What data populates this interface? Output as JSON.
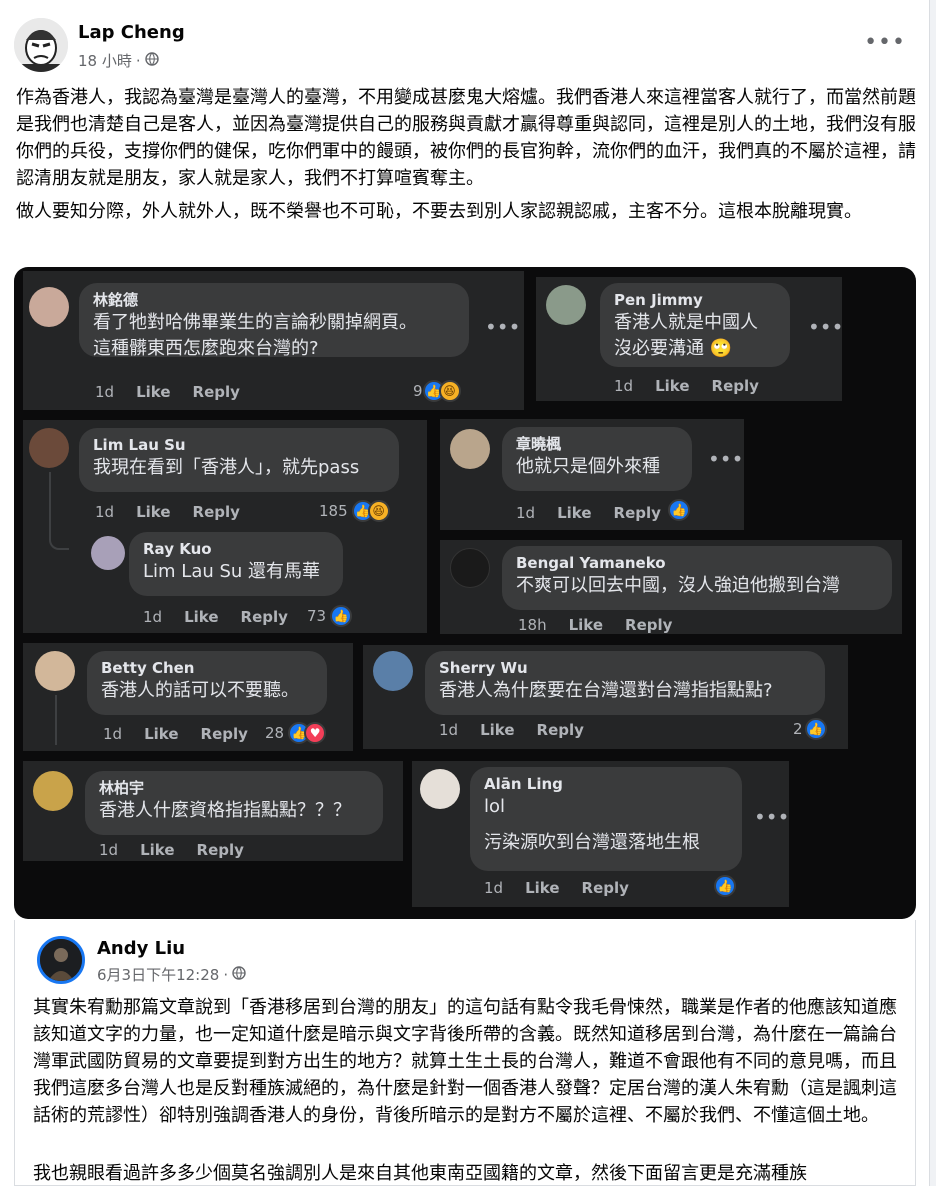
{
  "post": {
    "author": "Lap Cheng",
    "time": "18 小時",
    "separator": "·",
    "privacy_icon": "globe-icon",
    "more": "•••",
    "paragraphs": [
      "作為香港人，我認為臺灣是臺灣人的臺灣，不用變成甚麼鬼大熔爐。我們香港人來這裡當客人就行了，而當然前題是我們也清楚自己是客人，並因為臺灣提供自己的服務與貢獻才贏得尊重與認同，這裡是別人的土地，我們沒有服你們的兵役，支撐你們的健保，吃你們軍中的饅頭，被你們的長官狗幹，流你們的血汗，我們真的不屬於這裡，請認清朋友就是朋友，家人就是家人，我們不打算喧賓奪主。",
      "做人要知分際，外人就外人，既不榮譽也不可恥，不要去到別人家認親認戚，主客不分。這根本脫離現實。"
    ]
  },
  "comments": {
    "like": "Like",
    "reply": "Reply",
    "dots": "•••",
    "items": [
      {
        "name": "林銘德",
        "lines": [
          "看了牠對哈佛畢業生的言論秒關掉網頁。",
          "這種髒東西怎麼跑來台灣的?"
        ],
        "time": "1d",
        "count": "9"
      },
      {
        "name": "Pen Jimmy",
        "lines": [
          "香港人就是中國人",
          "沒必要溝通"
        ],
        "time": "1d",
        "count": ""
      },
      {
        "name": "Lim Lau Su",
        "lines": [
          "我現在看到「香港人」，就先pass"
        ],
        "time": "1d",
        "count": "185"
      },
      {
        "name": "章曉楓",
        "lines": [
          "他就只是個外來種"
        ],
        "time": "1d",
        "count": ""
      },
      {
        "name": "Ray Kuo",
        "lines": [
          "Lim Lau Su 還有馬華"
        ],
        "time": "1d",
        "count": "73"
      },
      {
        "name": "Bengal Yamaneko",
        "lines": [
          "不爽可以回去中國，沒人強迫他搬到台灣"
        ],
        "time": "18h",
        "count": ""
      },
      {
        "name": "Betty Chen",
        "lines": [
          "香港人的話可以不要聽。"
        ],
        "time": "1d",
        "count": "28"
      },
      {
        "name": "Sherry Wu",
        "lines": [
          "香港人為什麼要在台灣還對台灣指指點點?"
        ],
        "time": "1d",
        "count": "2"
      },
      {
        "name": "林柏宇",
        "lines": [
          "香港人什麼資格指指點點？？？"
        ],
        "time": "1d",
        "count": ""
      },
      {
        "name": "Alān Ling",
        "lines": [
          "lol",
          "污染源吹到台灣還落地生根"
        ],
        "time": "1d",
        "count": ""
      }
    ]
  },
  "shared": {
    "author": "Andy Liu",
    "time": "6月3日下午12:28",
    "separator": "·",
    "paragraphs": [
      "其實朱宥勳那篇文章說到「香港移居到台灣的朋友」的這句話有點令我毛骨悚然，職業是作者的他應該知道應該知道文字的力量，也一定知道什麼是暗示與文字背後所帶的含義。既然知道移居到台灣，為什麼在一篇論台灣軍武國防貿易的文章要提到對方出生的地方？就算土生土長的台灣人，難道不會跟他有不同的意見嗎，而且我們這麼多台灣人也是反對種族滅絕的，為什麼是針對一個香港人發聲？定居台灣的漢人朱宥勳（這是諷刺這話術的荒謬性）卻特別強調香港人的身份，背後所暗示的是對方不屬於這裡、不屬於我們、不懂這個土地。",
      "我也親眼看過許多多少個莫名強調別人是來自其他東南亞國籍的文章，然後下面留言更是充滿種族"
    ]
  },
  "colors": {
    "link_blue": "#1877f2",
    "dark_bg": "#0b0b0c",
    "comment_bubble": "#3a3b3c",
    "comment_card": "#242526"
  }
}
